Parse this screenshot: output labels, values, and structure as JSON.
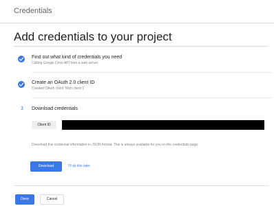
{
  "header": {
    "title": "Credentials"
  },
  "main": {
    "title": "Add credentials to your project",
    "steps": [
      {
        "title": "Find out what kind of credentials you need",
        "subtitle": "Calling Google Drive API from a web server",
        "status": "complete",
        "icon": "check-circle-icon"
      },
      {
        "title": "Create an OAuth 2.0 client ID",
        "subtitle": "Created OAuth client 'Web client 1'",
        "status": "complete",
        "icon": "check-circle-icon"
      },
      {
        "number": "3",
        "title": "Download credentials",
        "status": "current"
      }
    ],
    "client": {
      "label": "Client ID",
      "value_redacted": true
    },
    "download_note": "Download this credential information in JSON format. This is always available for you on the credentials page.",
    "download_button": "Download",
    "later_link": "I'll do this later"
  },
  "footer": {
    "done_button": "Done",
    "cancel_button": "Cancel"
  },
  "colors": {
    "accent": "#3b78e7",
    "redaction": "#000000"
  }
}
